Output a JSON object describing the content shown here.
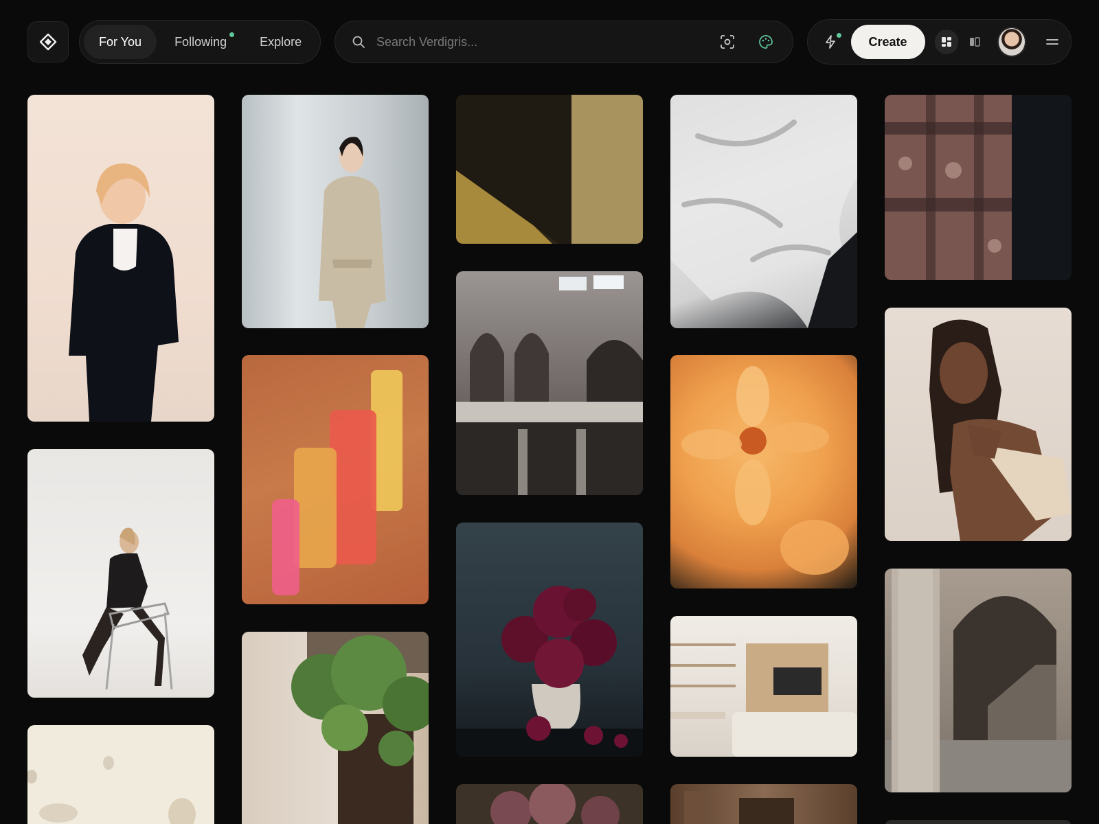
{
  "header": {
    "tabs": [
      {
        "label": "For You",
        "active": true
      },
      {
        "label": "Following",
        "active": false,
        "has_notification": true
      },
      {
        "label": "Explore",
        "active": false
      }
    ],
    "search": {
      "placeholder": "Search Verdigris...",
      "icons": [
        "search-icon",
        "visual-search-icon",
        "palette-icon"
      ]
    },
    "actions": {
      "create_label": "Create",
      "icons": [
        "lightning-icon",
        "grid-view-icon",
        "split-view-icon",
        "menu-icon"
      ],
      "active_view": "grid-view"
    },
    "logo_icon": "diamond-logo-icon"
  },
  "colors": {
    "background": "#0a0a0a",
    "panel": "#151515",
    "accent_dot": "#5fc79a",
    "create_button": "#f2f1ed"
  },
  "gallery": [
    {
      "name": "woman-black-blazer-photo"
    },
    {
      "name": "woman-beige-jumpsuit-photo"
    },
    {
      "name": "gold-texture-shadow-photo"
    },
    {
      "name": "white-linen-sheets-photo"
    },
    {
      "name": "window-shadow-wall-photo"
    },
    {
      "name": "woman-chair-photo"
    },
    {
      "name": "abstract-orange-painting"
    },
    {
      "name": "arched-atrium-photo"
    },
    {
      "name": "orange-dahlia-photo"
    },
    {
      "name": "woman-braids-portrait-photo"
    },
    {
      "name": "ceramic-objects-photo"
    },
    {
      "name": "ivy-doorway-photo"
    },
    {
      "name": "burgundy-flowers-vase-photo"
    },
    {
      "name": "minimal-living-room-photo"
    },
    {
      "name": "stone-column-archway-photo"
    },
    {
      "name": "dried-flowers-photo"
    },
    {
      "name": "wooden-interior-photo"
    }
  ]
}
